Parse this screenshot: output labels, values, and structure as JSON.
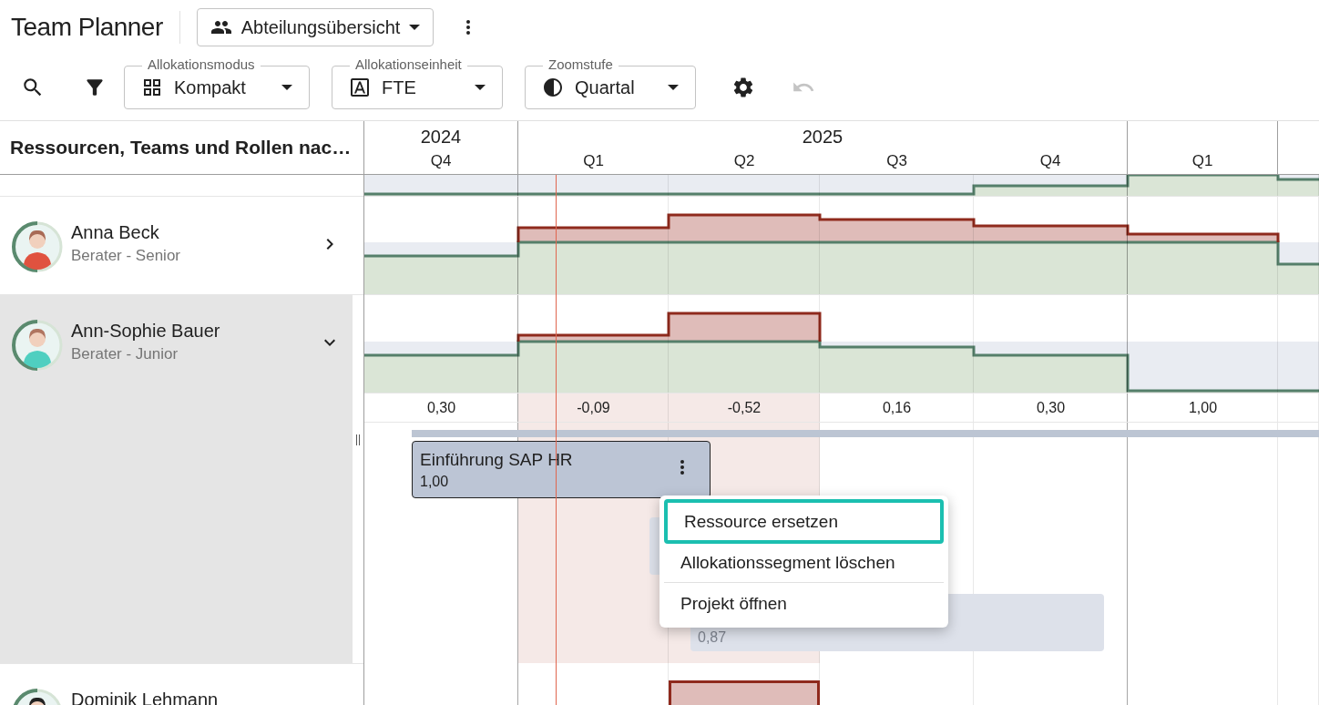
{
  "app": {
    "title": "Team Planner",
    "view_select": {
      "value": "Abteilungsübersicht"
    }
  },
  "toolbar": {
    "selects": [
      {
        "label": "Allokationsmodus",
        "value": "Kompakt",
        "kind": "grid"
      },
      {
        "label": "Allokationseinheit",
        "value": "FTE",
        "kind": "font"
      },
      {
        "label": "Zoomstufe",
        "value": "Quartal",
        "kind": "contrast"
      }
    ],
    "undo_disabled": true
  },
  "resources_header": "Ressourcen, Teams und Rollen nac…",
  "timeline": {
    "years": [
      {
        "label": "2024",
        "quarters": [
          "Q4"
        ]
      },
      {
        "label": "2025",
        "quarters": [
          "Q1",
          "Q2",
          "Q3",
          "Q4"
        ]
      },
      {
        "quarters": [
          "Q1"
        ]
      }
    ]
  },
  "resources": [
    {
      "name": "Anna Beck",
      "role": "Berater - Senior",
      "expanded": false,
      "selected": false
    },
    {
      "name": "Ann-Sophie Bauer",
      "role": "Berater - Junior",
      "expanded": true,
      "selected": true,
      "balance": [
        {
          "value": "0,30",
          "overbooked": false
        },
        {
          "value": "-0,09",
          "overbooked": true
        },
        {
          "value": "-0,52",
          "overbooked": true
        },
        {
          "value": "0,16",
          "overbooked": false
        },
        {
          "value": "0,30",
          "overbooked": false
        },
        {
          "value": "1,00",
          "overbooked": false
        }
      ],
      "allocations": [
        {
          "title": "Einführung SAP HR",
          "value": "1,00",
          "kind": "active"
        },
        {
          "value": "0,87",
          "kind": "faded"
        }
      ]
    },
    {
      "name": "Dominik Lehmann"
    }
  ],
  "context_menu": {
    "items": [
      {
        "label": "Ressource ersetzen",
        "highlighted": true,
        "divider_before": false
      },
      {
        "label": "Allokationssegment löschen",
        "highlighted": false,
        "divider_before": false
      },
      {
        "label": "Projekt öffnen",
        "highlighted": false,
        "divider_before": true
      }
    ]
  }
}
